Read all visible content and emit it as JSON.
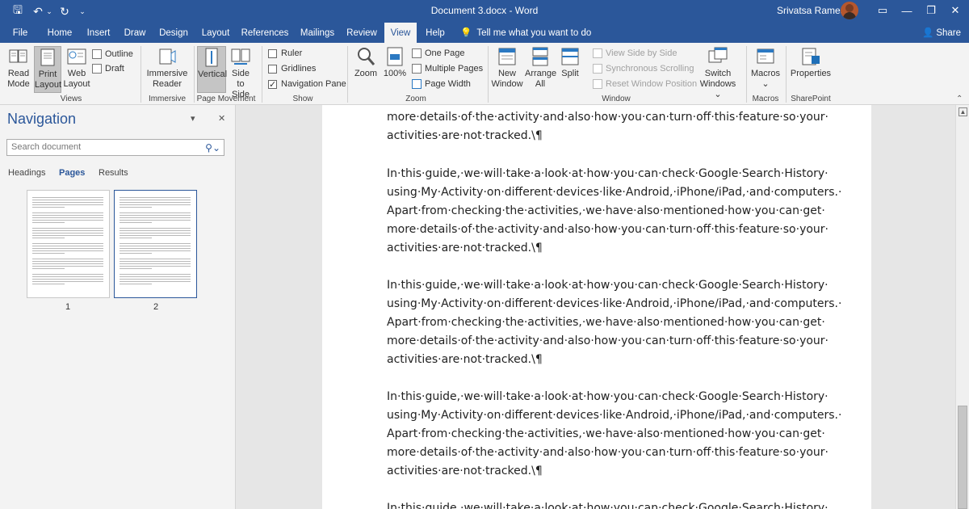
{
  "window": {
    "title": "Document 3.docx - Word",
    "user_name": "Srivatsa Ramesh"
  },
  "menu_tabs": [
    "File",
    "Home",
    "Insert",
    "Draw",
    "Design",
    "Layout",
    "References",
    "Mailings",
    "Review",
    "View",
    "Help"
  ],
  "active_tab": "View",
  "tell_me": "Tell me what you want to do",
  "share": "Share",
  "ribbon": {
    "views": {
      "label": "Views",
      "read_mode": [
        "Read",
        "Mode"
      ],
      "print_layout": [
        "Print",
        "Layout"
      ],
      "web_layout": [
        "Web",
        "Layout"
      ],
      "outline": "Outline",
      "draft": "Draft"
    },
    "immersive": {
      "label": "Immersive",
      "immersive_reader": [
        "Immersive",
        "Reader"
      ]
    },
    "page_movement": {
      "label": "Page Movement",
      "vertical": "Vertical",
      "side_to_side": [
        "Side",
        "to Side"
      ]
    },
    "show": {
      "label": "Show",
      "ruler": "Ruler",
      "gridlines": "Gridlines",
      "navigation_pane": "Navigation Pane"
    },
    "zoom": {
      "label": "Zoom",
      "zoom": "Zoom",
      "hundred": "100%",
      "one_page": "One Page",
      "multiple_pages": "Multiple Pages",
      "page_width": "Page Width"
    },
    "window": {
      "label": "Window",
      "new_window": [
        "New",
        "Window"
      ],
      "arrange_all": [
        "Arrange",
        "All"
      ],
      "split": "Split",
      "view_side_by_side": "View Side by Side",
      "synchronous_scrolling": "Synchronous Scrolling",
      "reset_window_position": "Reset Window Position",
      "switch_windows": [
        "Switch",
        "Windows ⌄"
      ]
    },
    "macros": {
      "label": "Macros",
      "macros": "Macros"
    },
    "sharepoint": {
      "label": "SharePoint",
      "properties": "Properties"
    }
  },
  "navigation": {
    "title": "Navigation",
    "search_placeholder": "Search document",
    "tabs": [
      "Headings",
      "Pages",
      "Results"
    ],
    "active_tab": "Pages",
    "page_numbers": [
      "1",
      "2"
    ]
  },
  "document": {
    "partial_top": [
      "more·details·of·the·activity·and·also·how·you·can·turn·off·this·feature·so·your·",
      "activities·are·not·tracked.\\¶"
    ],
    "paragraph": [
      "In·this·guide,·we·will·take·a·look·at·how·you·can·check·Google·Search·History·",
      "using·My·Activity·on·different·devices·like·Android,·iPhone/iPad,·and·computers.·",
      "Apart·from·checking·the·activities,·we·have·also·mentioned·how·you·can·get·",
      "more·details·of·the·activity·and·also·how·you·can·turn·off·this·feature·so·your·",
      "activities·are·not·tracked.\\¶"
    ],
    "partial_bottom": "In·this·guide,·we·will·take·a·look·at·how·you·can·check·Google·Search·History·"
  }
}
